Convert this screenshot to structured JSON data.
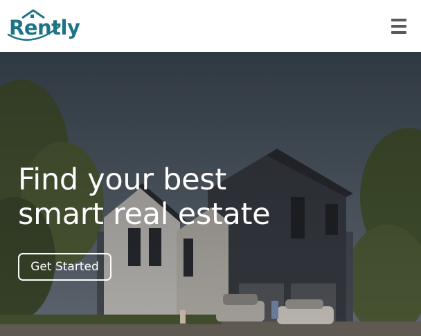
{
  "header": {
    "logo_text": "Rently",
    "menu_icon": "hamburger-menu-icon"
  },
  "hero": {
    "title_line1": "Find your best",
    "title_line2": "smart real estate",
    "cta_label": "Get Started"
  },
  "colors": {
    "brand": "#1d7486",
    "menu_icon": "#5a5a5a",
    "hero_text": "#ffffff",
    "header_bg": "#ffffff"
  }
}
